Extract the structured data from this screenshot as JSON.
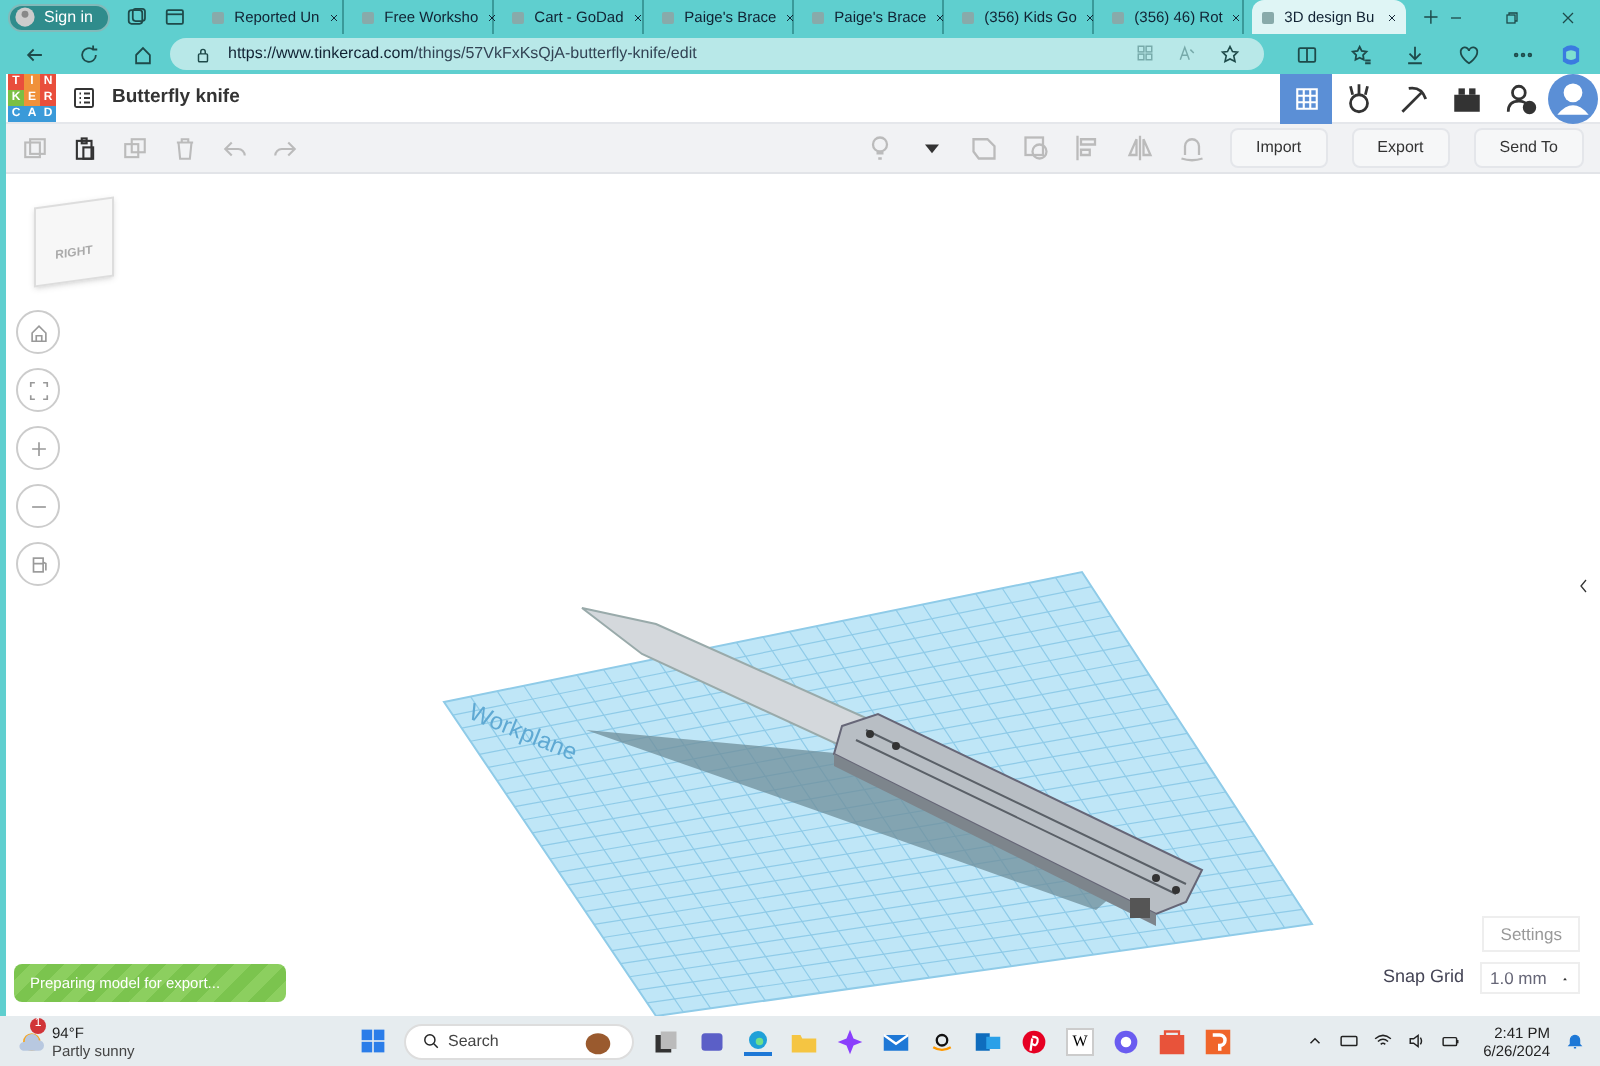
{
  "browser": {
    "profile": {
      "label": "Sign in"
    },
    "tabs": [
      {
        "label": "Reported Un",
        "selected": false
      },
      {
        "label": "Free Worksho",
        "selected": false
      },
      {
        "label": "Cart - GoDad",
        "selected": false
      },
      {
        "label": "Paige's Brace",
        "selected": false
      },
      {
        "label": "Paige's Brace",
        "selected": false
      },
      {
        "label": "(356) Kids Go",
        "selected": false
      },
      {
        "label": "(356) 46) Rot",
        "selected": false
      },
      {
        "label": "3D design Bu",
        "selected": true
      }
    ],
    "url": {
      "host": "https://www.tinkercad.com",
      "path": "/things/57VkFxKsQjA-butterfly-knife/edit"
    }
  },
  "app": {
    "logo": [
      "T",
      "I",
      "N",
      "K",
      "E",
      "R",
      "C",
      "A",
      "D"
    ],
    "title": "Butterfly knife",
    "toolbar_buttons": [
      "Import",
      "Export",
      "Send To"
    ],
    "view_cube": {
      "label": "RIGHT"
    },
    "workplane_label": "Workplane",
    "settings": "Settings",
    "snap_grid": {
      "label": "Snap Grid",
      "value": "1.0 mm"
    },
    "toast": "Preparing model for export..."
  },
  "taskbar": {
    "weather": {
      "badge": "1",
      "temperature": "94°F",
      "condition": "Partly sunny"
    },
    "search": {
      "placeholder": "Search"
    },
    "wiki_letter": "W",
    "clock": {
      "time": "2:41 PM",
      "date": "6/26/2024"
    }
  }
}
